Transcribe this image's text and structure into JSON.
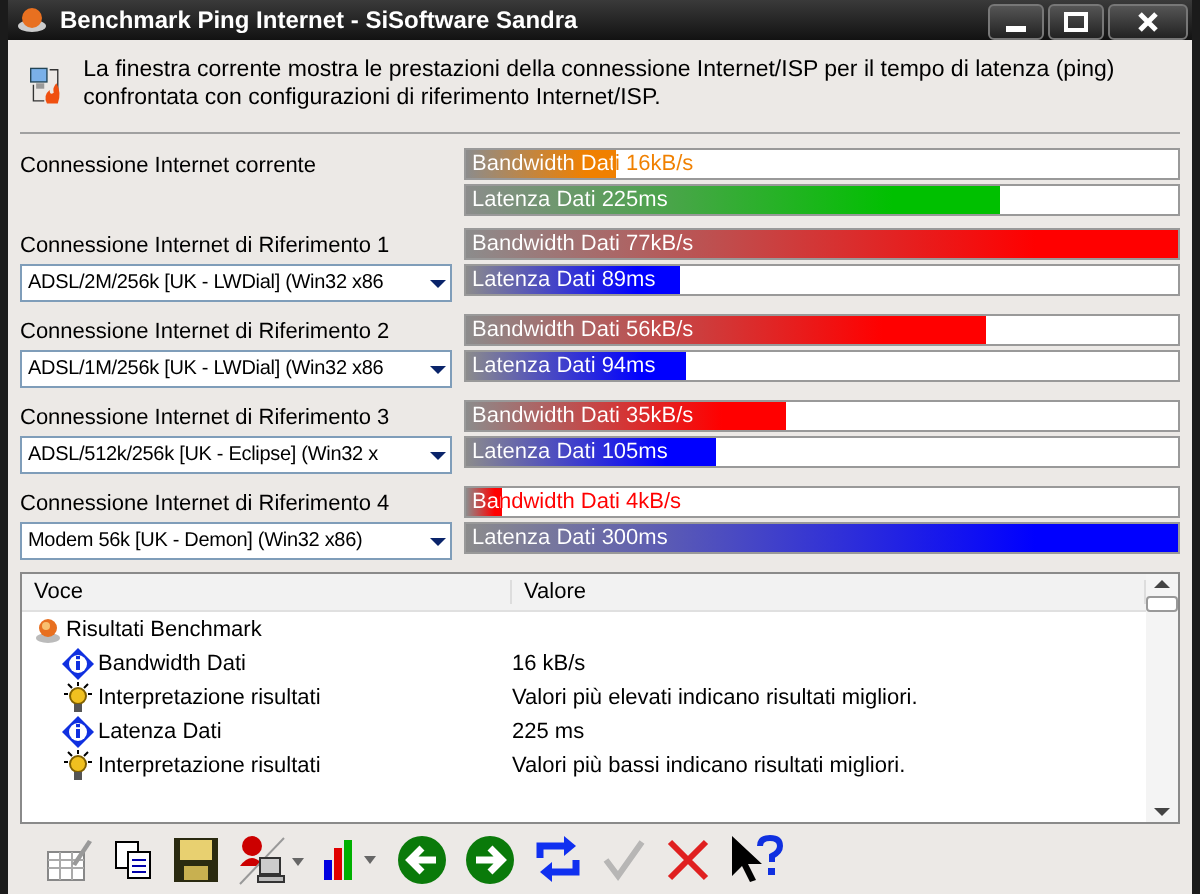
{
  "window": {
    "title": "Benchmark Ping Internet - SiSoftware Sandra"
  },
  "description": "La finestra corrente mostra le prestazioni della connessione Internet/ISP per il tempo di latenza (ping) confrontata con configurazioni di riferimento Internet/ISP.",
  "connections": [
    {
      "label": "Connessione Internet corrente",
      "bars": [
        {
          "text": "Bandwidth Dati 16kB/s",
          "level": 0.21,
          "color": "#f08000"
        },
        {
          "text": "Latenza Dati 225ms",
          "level": 0.75,
          "color": "#00c000"
        }
      ]
    },
    {
      "label": "Connessione Internet di Riferimento 1",
      "dropdown": "ADSL/2M/256k [UK - LWDial] (Win32 x86",
      "bars": [
        {
          "text": "Bandwidth Dati 77kB/s",
          "level": 1.0,
          "color": "#ff0000"
        },
        {
          "text": "Latenza Dati 89ms",
          "level": 0.3,
          "color": "#0000ff"
        }
      ]
    },
    {
      "label": "Connessione Internet di Riferimento 2",
      "dropdown": "ADSL/1M/256k [UK - LWDial] (Win32 x86",
      "bars": [
        {
          "text": "Bandwidth Dati 56kB/s",
          "level": 0.73,
          "color": "#ff0000"
        },
        {
          "text": "Latenza Dati 94ms",
          "level": 0.31,
          "color": "#0000ff"
        }
      ]
    },
    {
      "label": "Connessione Internet di Riferimento 3",
      "dropdown": "ADSL/512k/256k [UK - Eclipse] (Win32 x",
      "bars": [
        {
          "text": "Bandwidth Dati 35kB/s",
          "level": 0.45,
          "color": "#ff0000"
        },
        {
          "text": "Latenza Dati 105ms",
          "level": 0.35,
          "color": "#0000ff"
        }
      ]
    },
    {
      "label": "Connessione Internet di Riferimento 4",
      "dropdown": "Modem 56k [UK - Demon] (Win32 x86)",
      "bars": [
        {
          "text": "Bandwidth Dati 4kB/s",
          "level": 0.05,
          "color": "#ff0000"
        },
        {
          "text": "Latenza Dati 300ms",
          "level": 1.0,
          "color": "#0000ff"
        }
      ]
    }
  ],
  "results": {
    "columns": [
      "Voce",
      "Valore"
    ],
    "tree": [
      {
        "label": "Risultati Benchmark",
        "kind": "group",
        "children": [
          {
            "kind": "info",
            "label": "Bandwidth Dati",
            "value": "16 kB/s"
          },
          {
            "kind": "tip",
            "label": "Interpretazione risultati",
            "value": "Valori più elevati indicano risultati migliori."
          },
          {
            "kind": "info",
            "label": "Latenza Dati",
            "value": "225 ms"
          },
          {
            "kind": "tip",
            "label": "Interpretazione risultati",
            "value": "Valori più bassi indicano risultati migliori."
          }
        ]
      }
    ]
  },
  "toolbar": [
    {
      "kind": "options",
      "disabled": false
    },
    {
      "kind": "copy",
      "disabled": false
    },
    {
      "kind": "save",
      "disabled": false
    },
    {
      "kind": "user",
      "disabled": false
    },
    {
      "kind": "chart",
      "disabled": false
    },
    {
      "kind": "back",
      "disabled": false
    },
    {
      "kind": "forward",
      "disabled": false
    },
    {
      "kind": "refresh",
      "disabled": false
    },
    {
      "kind": "ok",
      "disabled": true
    },
    {
      "kind": "cancel",
      "disabled": false
    },
    {
      "kind": "help",
      "disabled": false
    }
  ]
}
